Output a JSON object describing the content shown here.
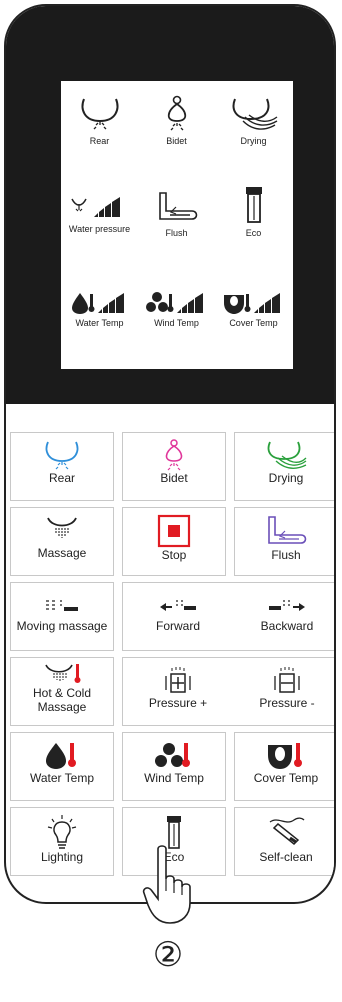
{
  "screen": {
    "row1": [
      "Rear",
      "Bidet",
      "Drying"
    ],
    "row2": [
      "Water pressure",
      "Flush",
      "Eco"
    ],
    "row3": [
      "Water Temp",
      "Wind Temp",
      "Cover Temp"
    ]
  },
  "buttons": {
    "rear": "Rear",
    "bidet": "Bidet",
    "drying": "Drying",
    "massage": "Massage",
    "stop": "Stop",
    "flush": "Flush",
    "moving_massage": "Moving massage",
    "forward": "Forward",
    "backward": "Backward",
    "hot_cold_1": "Hot & Cold",
    "hot_cold_2": "Massage",
    "pressure_plus": "Pressure +",
    "pressure_minus": "Pressure -",
    "water_temp": "Water Temp",
    "wind_temp": "Wind Temp",
    "cover_temp": "Cover Temp",
    "lighting": "Lighting",
    "eco": "Eco",
    "self_clean": "Self-clean"
  },
  "step_marker": "②",
  "colors": {
    "rear": "#2f8fd9",
    "bidet": "#e0359a",
    "drying": "#2aa03c",
    "stop": "#e11b22",
    "flush": "#6a4fb8",
    "temp": "#e11b22"
  }
}
